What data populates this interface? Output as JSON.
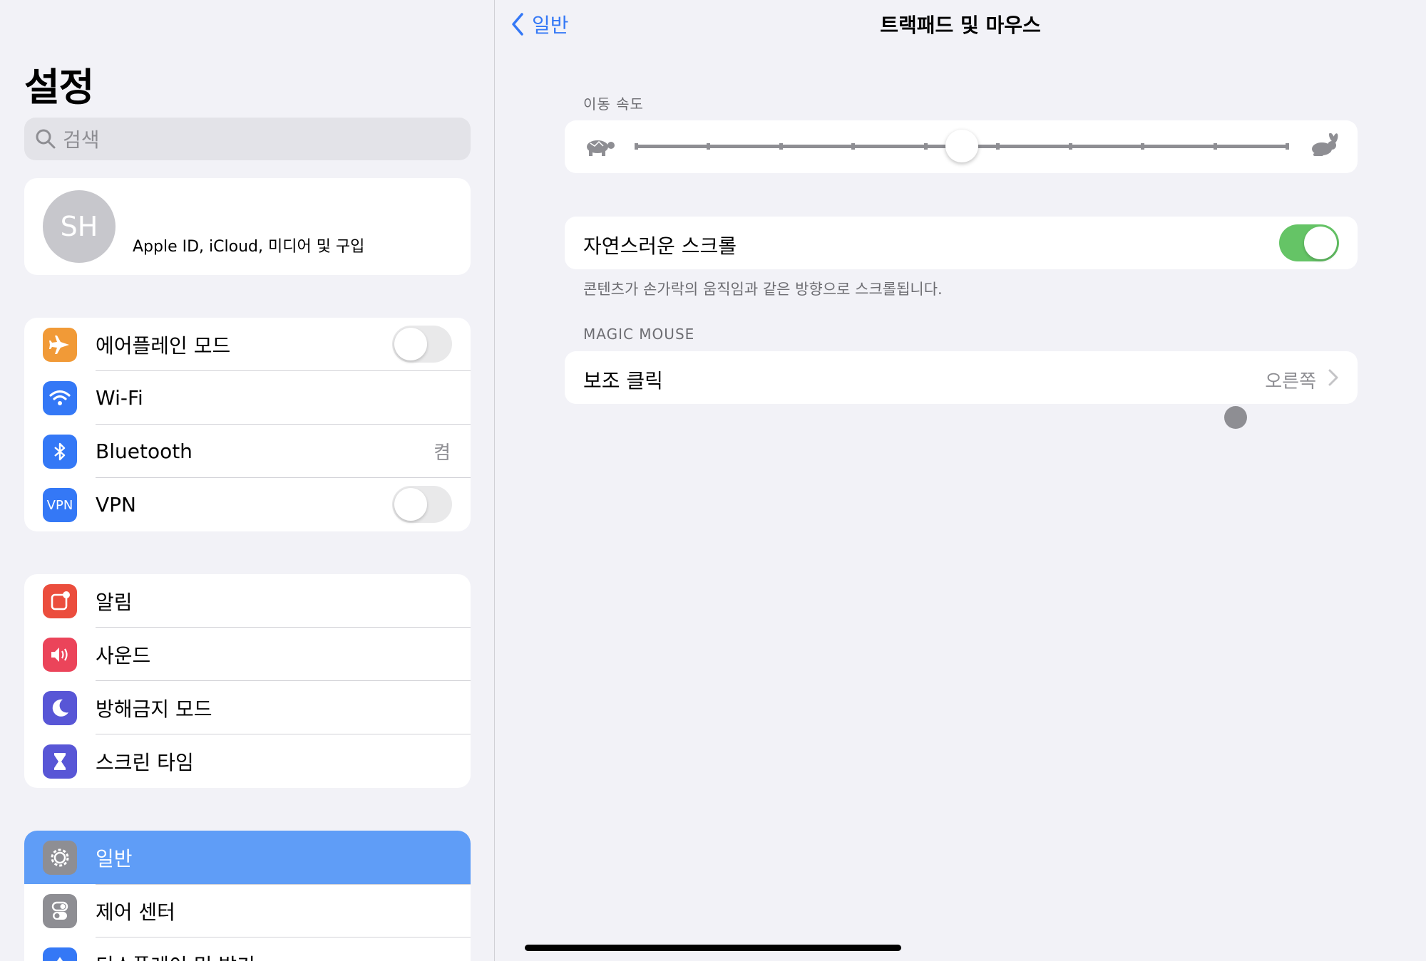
{
  "sidebar": {
    "title": "설정",
    "search_placeholder": "검색",
    "profile": {
      "initials": "SH",
      "subtitle": "Apple ID, iCloud, 미디어 및 구입"
    },
    "group1": [
      {
        "label": "에어플레인 모드",
        "icon": "airplane-icon",
        "color": "#f19a37",
        "toggle": false
      },
      {
        "label": "Wi-Fi",
        "icon": "wifi-icon",
        "color": "#3478f6"
      },
      {
        "label": "Bluetooth",
        "icon": "bluetooth-icon",
        "color": "#3478f6",
        "value": "켬"
      },
      {
        "label": "VPN",
        "icon": "vpn-icon",
        "color": "#3478f6",
        "icon_text": "VPN",
        "toggle": false
      }
    ],
    "group2": [
      {
        "label": "알림",
        "icon": "notifications-icon",
        "color": "#eb4d3d"
      },
      {
        "label": "사운드",
        "icon": "sound-icon",
        "color": "#eb445a"
      },
      {
        "label": "방해금지 모드",
        "icon": "moon-icon",
        "color": "#5856d6"
      },
      {
        "label": "스크린 타임",
        "icon": "hourglass-icon",
        "color": "#5856d6"
      }
    ],
    "group3": [
      {
        "label": "일반",
        "icon": "gear-icon",
        "color": "#8e8e93",
        "selected": true
      },
      {
        "label": "제어 센터",
        "icon": "control-center-icon",
        "color": "#8e8e93"
      },
      {
        "label": "디스플레이 및 밝기",
        "icon": "display-icon",
        "color": "#3478f6"
      }
    ]
  },
  "main": {
    "back_label": "일반",
    "title": "트랙패드 및 마우스",
    "tracking_speed": {
      "section_label": "이동 속도",
      "value_fraction": 0.5,
      "ticks": 10,
      "slow_icon": "turtle-icon",
      "fast_icon": "rabbit-icon"
    },
    "natural_scrolling": {
      "label": "자연스러운 스크롤",
      "on": true,
      "footer": "콘텐츠가 손가락의 움직임과 같은 방향으로 스크롤됩니다."
    },
    "magic_mouse": {
      "section_label": "MAGIC MOUSE",
      "secondary_click_label": "보조 클릭",
      "secondary_click_value": "오른쪽"
    }
  },
  "colors": {
    "accent": "#3478f6",
    "toggle_on": "#65c466",
    "selected_row": "#5f9df7"
  }
}
